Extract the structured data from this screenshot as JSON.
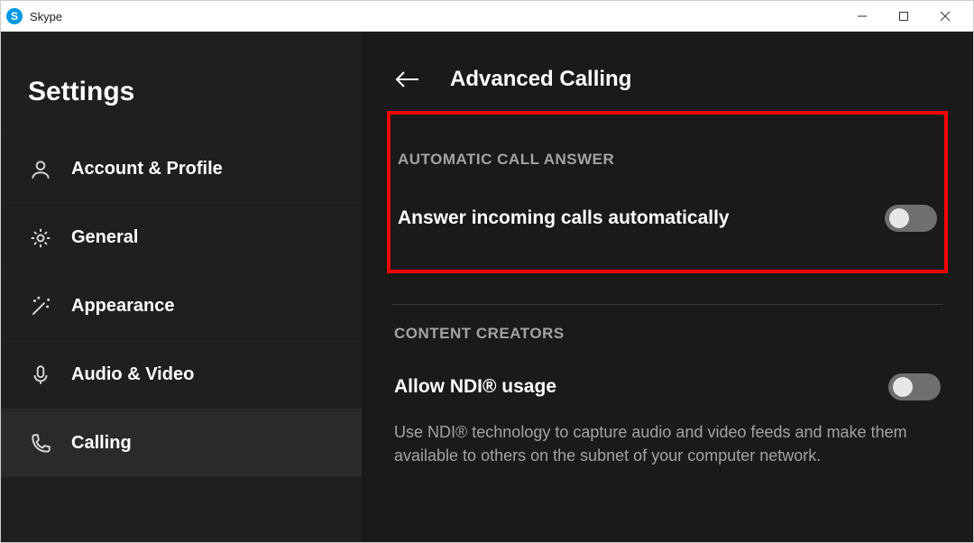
{
  "titlebar": {
    "app_name": "Skype",
    "logo_letter": "S"
  },
  "sidebar": {
    "title": "Settings",
    "items": {
      "account": {
        "label": "Account & Profile"
      },
      "general": {
        "label": "General"
      },
      "appearance": {
        "label": "Appearance"
      },
      "audio": {
        "label": "Audio & Video"
      },
      "calling": {
        "label": "Calling"
      }
    }
  },
  "content": {
    "title": "Advanced Calling",
    "auto_answer": {
      "section_title": "AUTOMATIC CALL ANSWER",
      "label": "Answer incoming calls automatically"
    },
    "creators": {
      "section_title": "CONTENT CREATORS",
      "ndi_label": "Allow NDI® usage",
      "ndi_desc": "Use NDI® technology to capture audio and video feeds and make them available to others on the subnet of your computer network."
    }
  }
}
